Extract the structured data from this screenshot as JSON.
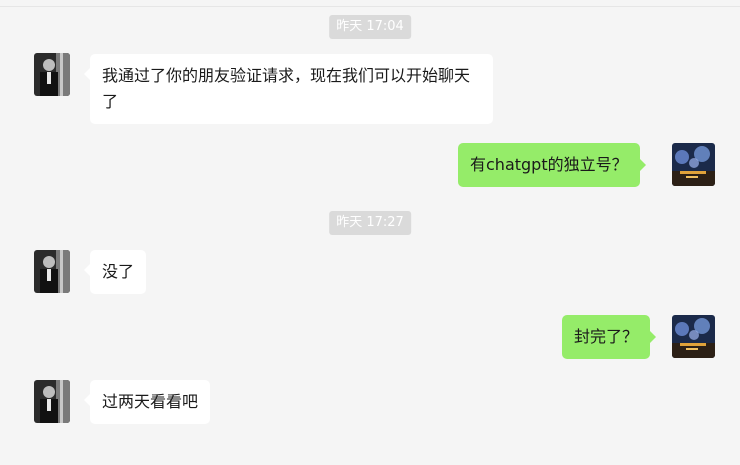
{
  "chat": {
    "timestamp_1": "昨天 17:04",
    "timestamp_2": "昨天 17:27",
    "messages": [
      {
        "from": "contact",
        "text": "我通过了你的朋友验证请求，现在我们可以开始聊天了"
      },
      {
        "from": "me",
        "text": "有chatgpt的独立号？"
      },
      {
        "from": "contact",
        "text": "没了"
      },
      {
        "from": "me",
        "text": "封完了？"
      },
      {
        "from": "contact",
        "text": "过两天看看吧"
      }
    ]
  },
  "colors": {
    "background": "#f5f5f5",
    "incoming_bubble": "#ffffff",
    "outgoing_bubble": "#95ec69",
    "timestamp_bg": "#dadada"
  },
  "icons": {
    "contact_avatar": "person-in-suit-avatar-icon",
    "my_avatar": "night-city-lights-avatar-icon"
  }
}
